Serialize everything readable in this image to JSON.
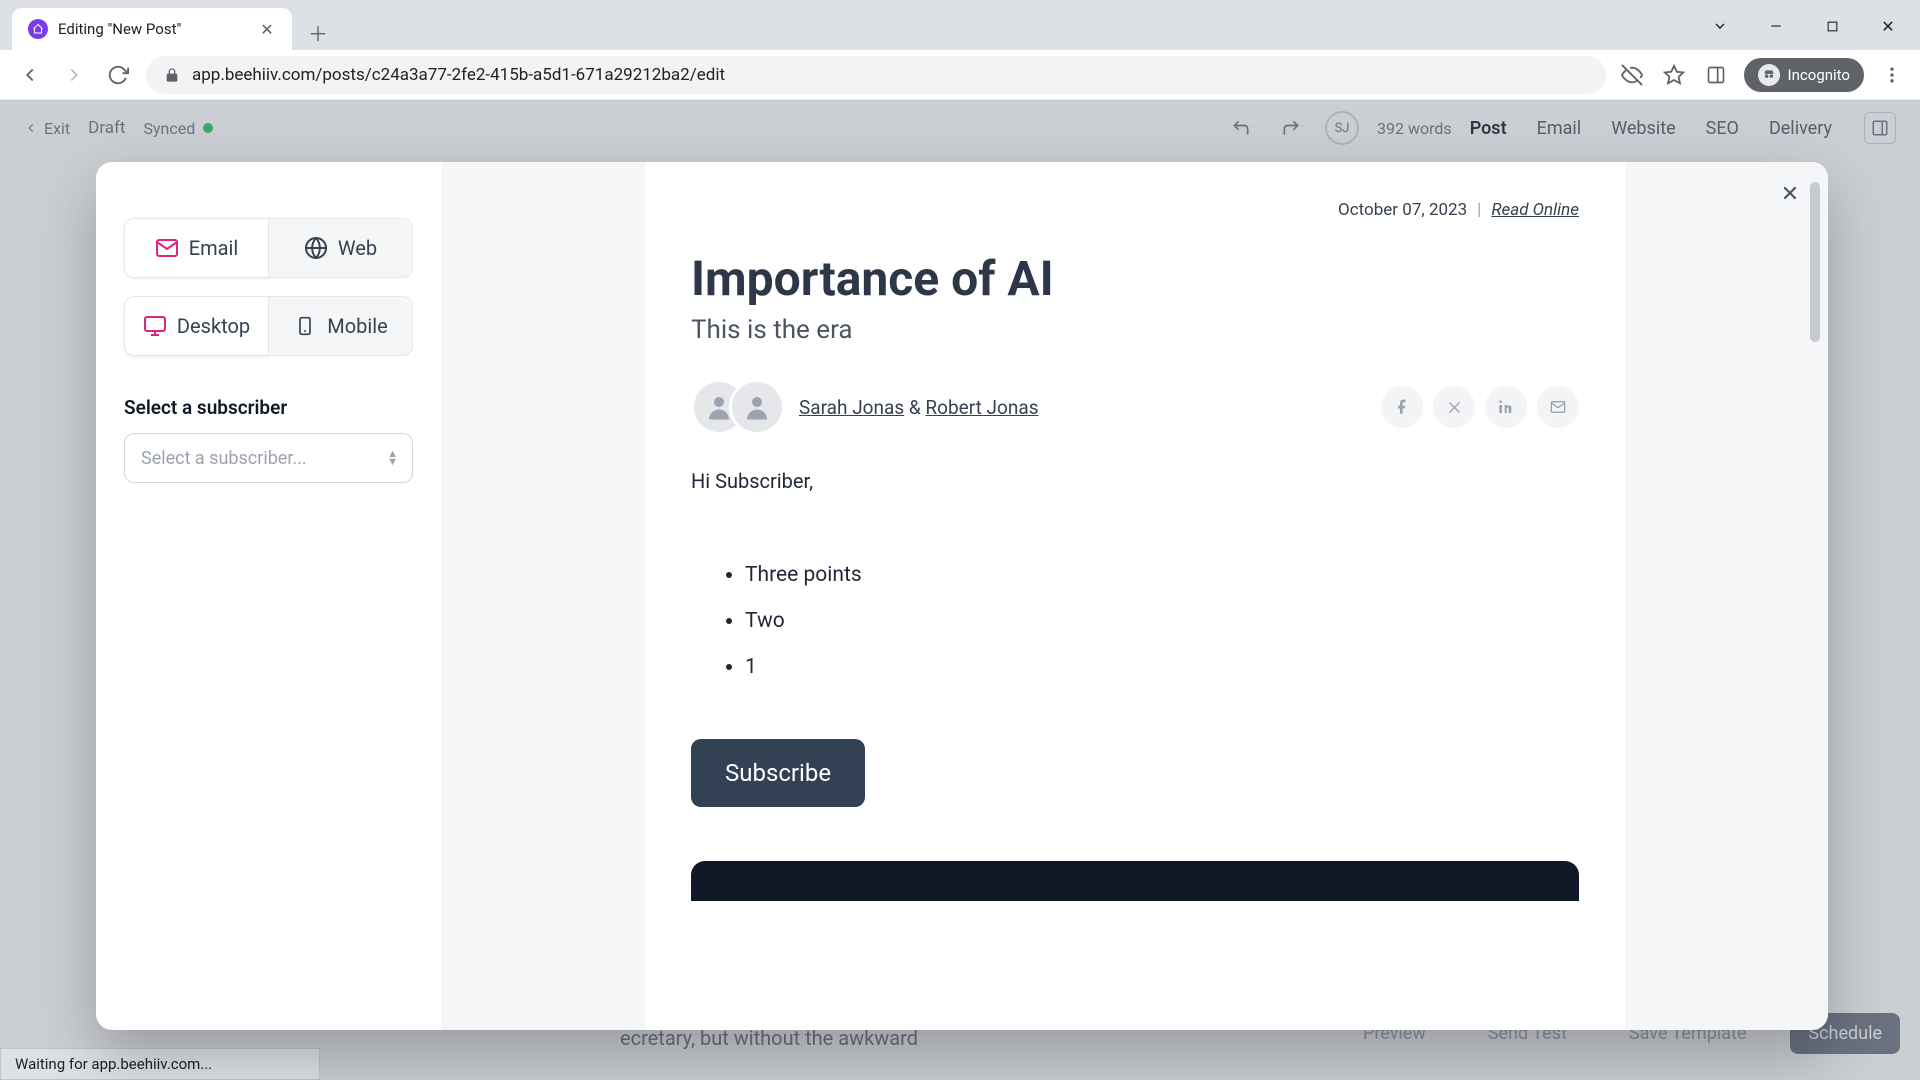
{
  "browser": {
    "tab_title": "Editing \"New Post\"",
    "url": "app.beehiiv.com/posts/c24a3a77-2fe2-415b-a5d1-671a29212ba2/edit",
    "incognito_label": "Incognito"
  },
  "header": {
    "exit": "Exit",
    "draft": "Draft",
    "synced": "Synced",
    "avatar_initials": "SJ",
    "word_count": "392 words",
    "tabs": [
      "Post",
      "Email",
      "Website",
      "SEO",
      "Delivery"
    ]
  },
  "footer": {
    "preview": "Preview",
    "send_test": "Send Test",
    "save_template": "Save Template",
    "schedule": "Schedule",
    "body_peek": "ecretary, but without the awkward"
  },
  "status_strip": "Waiting for app.beehiiv.com...",
  "modal": {
    "toggles_view": {
      "email": "Email",
      "web": "Web"
    },
    "toggles_device": {
      "desktop": "Desktop",
      "mobile": "Mobile"
    },
    "subscriber_label": "Select a subscriber",
    "subscriber_placeholder": "Select a subscriber..."
  },
  "preview": {
    "date": "October 07, 2023",
    "separator": "|",
    "read_online": "Read Online",
    "title": "Importance of AI",
    "subtitle": "This is the era",
    "author1": "Sarah Jonas",
    "amp": "&",
    "author2": "Robert Jonas",
    "greeting": "Hi Subscriber,",
    "bullets": [
      "Three points",
      "Two",
      "1"
    ],
    "subscribe": "Subscribe"
  }
}
